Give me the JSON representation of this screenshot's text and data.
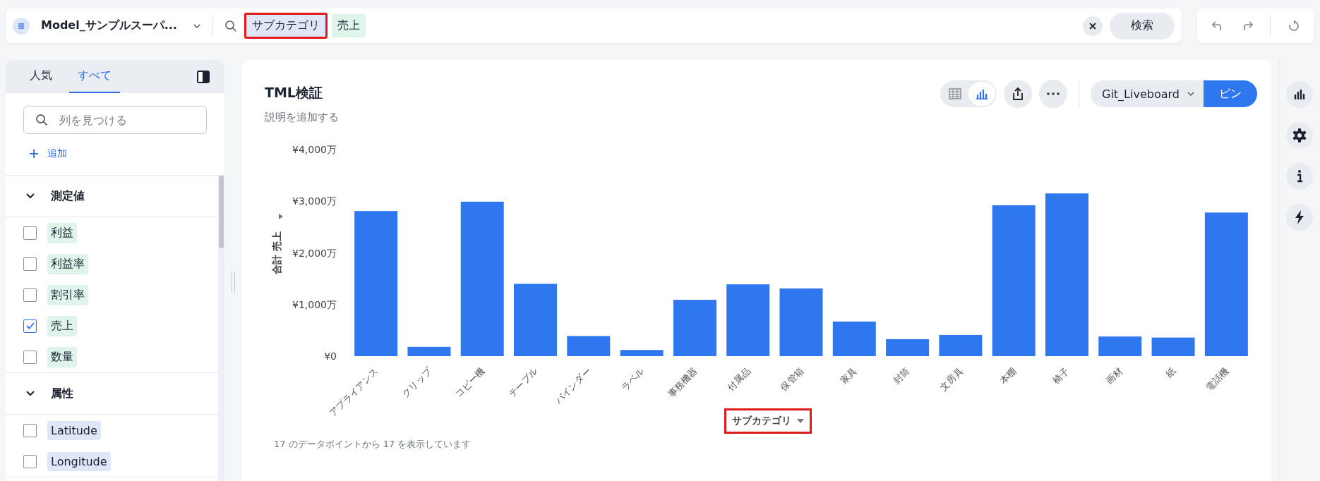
{
  "search_bar": {
    "source": "Model_サンプルスーパ...",
    "tokens": [
      {
        "text": "サブカテゴリ",
        "kind": "attribute",
        "highlighted": true
      },
      {
        "text": "売上",
        "kind": "measure",
        "highlighted": false
      }
    ],
    "search_button": "検索"
  },
  "sidebar": {
    "tabs": [
      {
        "label": "人気",
        "selected": false
      },
      {
        "label": "すべて",
        "selected": true
      }
    ],
    "search": {
      "placeholder": "列を見つける"
    },
    "add_label": "追加",
    "sections": [
      {
        "title": "測定値",
        "expanded": true,
        "items": [
          {
            "label": "利益",
            "kind": "measure",
            "checked": false
          },
          {
            "label": "利益率",
            "kind": "measure",
            "checked": false
          },
          {
            "label": "割引率",
            "kind": "measure",
            "checked": false
          },
          {
            "label": "売上",
            "kind": "measure",
            "checked": true
          },
          {
            "label": "数量",
            "kind": "measure",
            "checked": false
          }
        ]
      },
      {
        "title": "属性",
        "expanded": true,
        "items": [
          {
            "label": "Latitude",
            "kind": "attribute",
            "checked": false
          },
          {
            "label": "Longitude",
            "kind": "attribute",
            "checked": false
          }
        ]
      }
    ]
  },
  "answer": {
    "title": "TML検証",
    "description": "説明を追加する",
    "view_toggle": [
      {
        "kind": "table",
        "selected": false
      },
      {
        "kind": "chart",
        "selected": true
      }
    ],
    "liveboard": "Git_Liveboard",
    "pin_button": "ピン",
    "chart_data": {
      "type": "bar",
      "ylabel": "合計 売上",
      "xlabel": "サブカテゴリ",
      "categories": [
        "アプライアンス",
        "クリップ",
        "コピー機",
        "テーブル",
        "バインダー",
        "ラベル",
        "事務機器",
        "付属品",
        "保管箱",
        "家具",
        "封筒",
        "文房具",
        "本棚",
        "椅子",
        "画材",
        "紙",
        "電話機"
      ],
      "values": [
        2810,
        180,
        2990,
        1400,
        390,
        120,
        1090,
        1390,
        1310,
        670,
        330,
        410,
        2920,
        3150,
        380,
        360,
        2780
      ],
      "ylim": [
        0,
        4000
      ],
      "yticks": [
        {
          "value": 0,
          "label": "¥0"
        },
        {
          "value": 1000,
          "label": "¥1,000万"
        },
        {
          "value": 2000,
          "label": "¥2,000万"
        },
        {
          "value": 3000,
          "label": "¥3,000万"
        },
        {
          "value": 4000,
          "label": "¥4,000万"
        }
      ]
    },
    "xlabel_highlighted": true,
    "footer": "17 のデータポイントから 17 を表示しています"
  }
}
